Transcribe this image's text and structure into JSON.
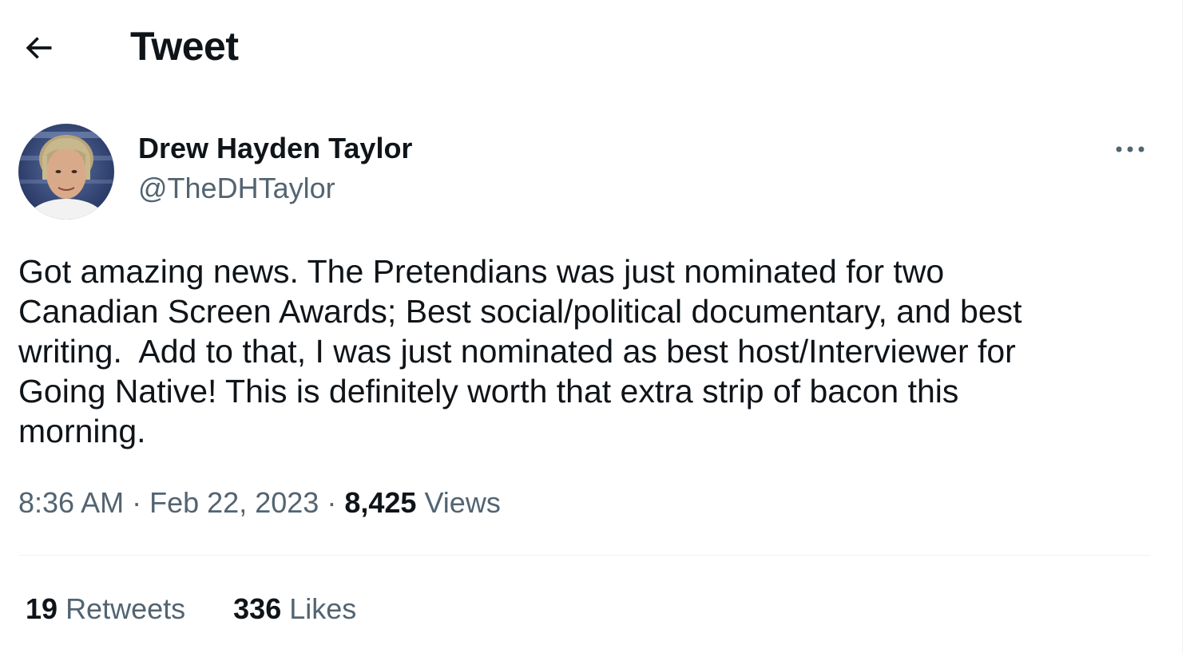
{
  "header": {
    "back_icon": "arrow-left-icon",
    "title": "Tweet"
  },
  "author": {
    "name": "Drew Hayden Taylor",
    "handle": "@TheDHTaylor",
    "avatar_icon": "profile-photo"
  },
  "more_icon": "ellipsis-icon",
  "tweet": {
    "text": "Got amazing news. The Pretendians was just nominated for two\nCanadian Screen Awards; Best social/political documentary, and best\nwriting.  Add to that, I was just nominated as best host/Interviewer for\nGoing Native! This is definitely worth that extra strip of bacon this\nmorning."
  },
  "meta": {
    "time": "8:36 AM",
    "separator": "·",
    "date": "Feb 22, 2023",
    "views_count": "8,425",
    "views_label": "Views"
  },
  "stats": {
    "retweets_count": "19",
    "retweets_label": "Retweets",
    "likes_count": "336",
    "likes_label": "Likes"
  },
  "colors": {
    "text_primary": "#0f1419",
    "text_secondary": "#536471",
    "divider": "#eff3f4"
  }
}
